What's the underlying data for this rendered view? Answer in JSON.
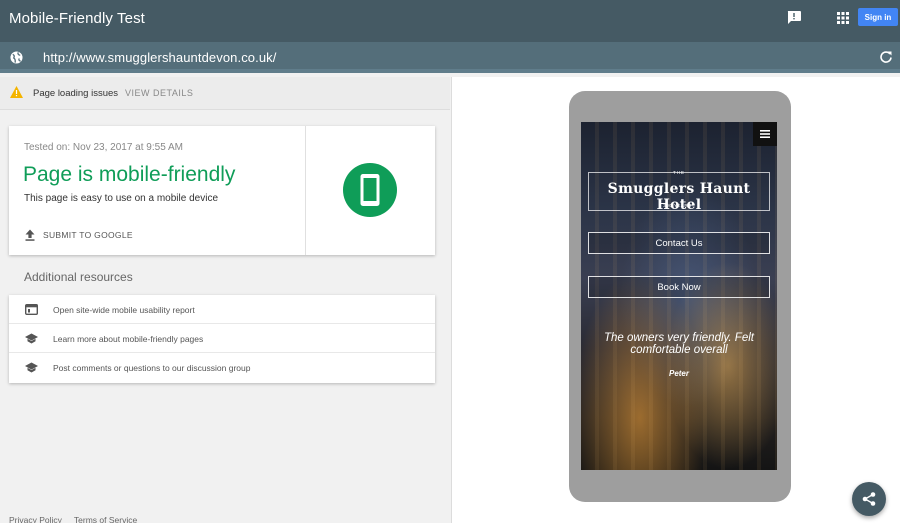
{
  "header": {
    "title": "Mobile-Friendly Test",
    "feedback_icon": "feedback-icon",
    "apps_icon": "apps-grid-icon",
    "signin_label": "Sign in",
    "accent_color": "#4285f4"
  },
  "urlbar": {
    "icon": "globe-icon",
    "url": "http://www.smugglershauntdevon.co.uk/",
    "reload_icon": "reload-icon"
  },
  "warning": {
    "icon": "warning-icon",
    "text": "Page loading issues",
    "action_label": "VIEW DETAILS"
  },
  "result": {
    "tested_on": "Tested on: Nov 23, 2017 at 9:55 AM",
    "title": "Page is mobile-friendly",
    "description": "This page is easy to use on a mobile device",
    "submit_label": "SUBMIT TO GOOGLE",
    "status_color": "#0f9d58",
    "badge_icon": "smartphone-icon"
  },
  "resources": {
    "title": "Additional resources",
    "items": [
      {
        "icon": "web-report-icon",
        "label": "Open site-wide mobile usability report"
      },
      {
        "icon": "school-icon",
        "label": "Learn more about mobile-friendly pages"
      },
      {
        "icon": "school-icon",
        "label": "Post comments or questions to our discussion group"
      }
    ]
  },
  "footer": {
    "privacy": "Privacy Policy",
    "terms": "Terms of Service"
  },
  "preview": {
    "logo_the": "THE",
    "logo_name": "Smugglers Haunt Hotel",
    "logo_years": "300 YEARS+",
    "contact_label": "Contact Us",
    "book_label": "Book Now",
    "testimonial": "The owners very friendly. Felt comfortable overall",
    "author": "Peter"
  },
  "share_icon": "share-icon"
}
